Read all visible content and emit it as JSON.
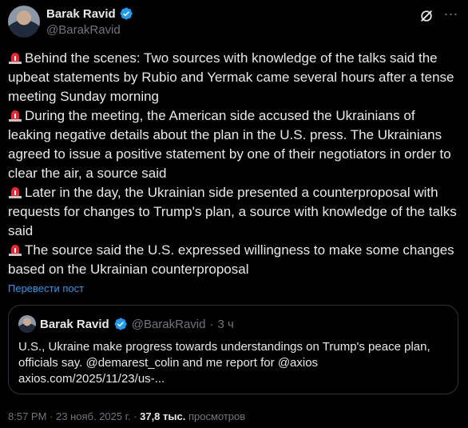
{
  "header": {
    "display_name": "Barak Ravid",
    "handle": "@BarakRavid"
  },
  "body": {
    "paragraphs": [
      "Behind the scenes: Two sources with knowledge of the talks said the upbeat statements by Rubio and Yermak came several hours after a tense meeting Sunday morning",
      "During the meeting, the American side accused the Ukrainians of leaking negative details about the plan in the U.S. press. The Ukrainians agreed to issue a positive statement by one of their negotiators in order to clear the air, a source said",
      "Later in the day, the Ukrainian side presented a counterproposal with requests for changes to Trump's plan, a source with knowledge of the talks said",
      "The source said the U.S. expressed willingness to make some changes based on the Ukrainian counterproposal"
    ]
  },
  "translate_label": "Перевести пост",
  "quote": {
    "display_name": "Barak Ravid",
    "handle": "@BarakRavid",
    "separator": "·",
    "time": "3 ч",
    "line1": "U.S., Ukraine make progress towards understandings on Trump's peace plan,",
    "line2": "officials say. @demarest_colin and me report for @axios",
    "line3": "axios.com/2025/11/23/us-..."
  },
  "footer": {
    "time": "8:57 PM",
    "sep1": "·",
    "date": "23 нояб. 2025 г.",
    "sep2": "·",
    "views_count": "37,8 тыс.",
    "views_label": "просмотров"
  },
  "colors": {
    "background": "#000000",
    "text": "#e7e9ea",
    "muted": "#71767b",
    "link": "#1d9bf0",
    "verified": "#1d9bf0",
    "siren": "#f4212e"
  },
  "icons": [
    "verified-badge-icon",
    "grok-icon",
    "more-icon",
    "siren-icon"
  ]
}
